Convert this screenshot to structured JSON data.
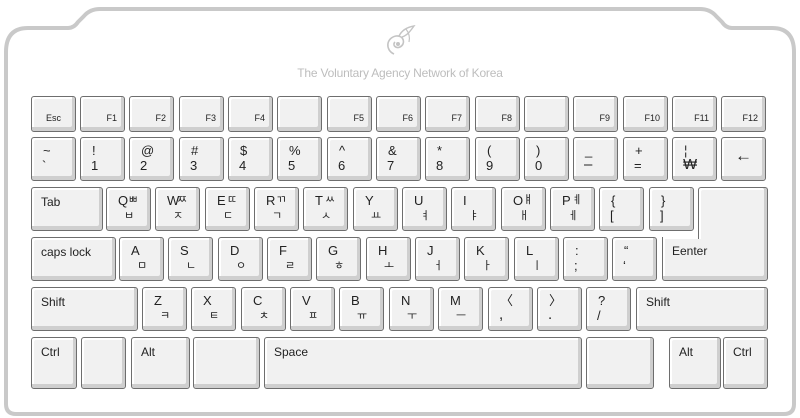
{
  "logo": {
    "text": "The Voluntary Agency Network of Korea",
    "icon": "leaf-swirl-icon"
  },
  "colors": {
    "frame": "#c9c9c9",
    "key_face": "#f1f1f1",
    "key_border": "#6e6e6e",
    "key_shade": "#cfcfcf",
    "logo": "#bdbdbd"
  },
  "rows": [
    {
      "keys": [
        {
          "id": "esc",
          "label": "Esc"
        },
        {
          "id": "f1",
          "label": "F1"
        },
        {
          "id": "f2",
          "label": "F2"
        },
        {
          "id": "f3",
          "label": "F3"
        },
        {
          "id": "f4",
          "label": "F4"
        },
        {
          "id": "blank-1",
          "label": ""
        },
        {
          "id": "f5",
          "label": "F5"
        },
        {
          "id": "f6",
          "label": "F6"
        },
        {
          "id": "f7",
          "label": "F7"
        },
        {
          "id": "f8",
          "label": "F8"
        },
        {
          "id": "blank-2",
          "label": ""
        },
        {
          "id": "f9",
          "label": "F9"
        },
        {
          "id": "f10",
          "label": "F10"
        },
        {
          "id": "f11",
          "label": "F11"
        },
        {
          "id": "f12",
          "label": "F12"
        }
      ]
    },
    {
      "keys": [
        {
          "id": "backtick",
          "top": "~",
          "bottom": "`"
        },
        {
          "id": "1",
          "top": "!",
          "bottom": "1"
        },
        {
          "id": "2",
          "top": "@",
          "bottom": "2"
        },
        {
          "id": "3",
          "top": "#",
          "bottom": "3"
        },
        {
          "id": "4",
          "top": "$",
          "bottom": "4"
        },
        {
          "id": "5",
          "top": "%",
          "bottom": "5"
        },
        {
          "id": "6",
          "top": "^",
          "bottom": "6"
        },
        {
          "id": "7",
          "top": "&",
          "bottom": "7"
        },
        {
          "id": "8",
          "top": "*",
          "bottom": "8"
        },
        {
          "id": "9",
          "top": "(",
          "bottom": "9"
        },
        {
          "id": "0",
          "top": ")",
          "bottom": "0"
        },
        {
          "id": "minus",
          "top": "_",
          "bottom": "–"
        },
        {
          "id": "equals",
          "top": "+",
          "bottom": "="
        },
        {
          "id": "won",
          "top": "¦",
          "bottom": "₩"
        },
        {
          "id": "backspace",
          "label": "←"
        }
      ]
    },
    {
      "keys": [
        {
          "id": "tab",
          "label": "Tab"
        },
        {
          "id": "q",
          "top": "Q",
          "han_top": "ㅃ",
          "han": "ㅂ"
        },
        {
          "id": "w",
          "top": "W",
          "han_top": "ㅉ",
          "han": "ㅈ"
        },
        {
          "id": "e",
          "top": "E",
          "han_top": "ㄸ",
          "han": "ㄷ"
        },
        {
          "id": "r",
          "top": "R",
          "han_top": "ㄲ",
          "han": "ㄱ"
        },
        {
          "id": "t",
          "top": "T",
          "han_top": "ㅆ",
          "han": "ㅅ"
        },
        {
          "id": "y",
          "top": "Y",
          "han": "ㅛ"
        },
        {
          "id": "u",
          "top": "U",
          "han": "ㅕ"
        },
        {
          "id": "i",
          "top": "I",
          "han": "ㅑ"
        },
        {
          "id": "o",
          "top": "O",
          "han_top": "ㅒ",
          "han": "ㅐ"
        },
        {
          "id": "p",
          "top": "P",
          "han_top": "ㅖ",
          "han": "ㅔ"
        },
        {
          "id": "lbracket",
          "top": "{",
          "bottom": "["
        },
        {
          "id": "rbracket",
          "top": "}",
          "bottom": "]"
        },
        {
          "id": "enter-top",
          "label": ""
        }
      ]
    },
    {
      "keys": [
        {
          "id": "caps",
          "label": "caps lock"
        },
        {
          "id": "a",
          "top": "A",
          "han": "ㅁ"
        },
        {
          "id": "s",
          "top": "S",
          "han": "ㄴ"
        },
        {
          "id": "d",
          "top": "D",
          "han": "ㅇ"
        },
        {
          "id": "f",
          "top": "F",
          "han": "ㄹ"
        },
        {
          "id": "g",
          "top": "G",
          "han": "ㅎ"
        },
        {
          "id": "h",
          "top": "H",
          "han": "ㅗ"
        },
        {
          "id": "j",
          "top": "J",
          "han": "ㅓ"
        },
        {
          "id": "k",
          "top": "K",
          "han": "ㅏ"
        },
        {
          "id": "l",
          "top": "L",
          "han": "ㅣ"
        },
        {
          "id": "semicolon",
          "top": ":",
          "bottom": ";"
        },
        {
          "id": "quote",
          "top": "“",
          "bottom": "‘"
        },
        {
          "id": "enter",
          "label": "Eenter"
        }
      ]
    },
    {
      "keys": [
        {
          "id": "lshift",
          "label": "Shift"
        },
        {
          "id": "z",
          "top": "Z",
          "han": "ㅋ"
        },
        {
          "id": "x",
          "top": "X",
          "han": "ㅌ"
        },
        {
          "id": "c",
          "top": "C",
          "han": "ㅊ"
        },
        {
          "id": "v",
          "top": "V",
          "han": "ㅍ"
        },
        {
          "id": "b",
          "top": "B",
          "han": "ㅠ"
        },
        {
          "id": "n",
          "top": "N",
          "han": "ㅜ"
        },
        {
          "id": "m",
          "top": "M",
          "han": "ㅡ"
        },
        {
          "id": "comma",
          "top": "〈",
          "bottom": ","
        },
        {
          "id": "period",
          "top": "〉",
          "bottom": "."
        },
        {
          "id": "slash",
          "top": "?",
          "bottom": "/"
        },
        {
          "id": "rshift",
          "label": "Shift"
        }
      ]
    },
    {
      "keys": [
        {
          "id": "lctrl",
          "label": "Ctrl"
        },
        {
          "id": "lwin",
          "label": ""
        },
        {
          "id": "lalt",
          "label": "Alt"
        },
        {
          "id": "hanja",
          "label": ""
        },
        {
          "id": "space",
          "label": "Space"
        },
        {
          "id": "hangul",
          "label": ""
        },
        {
          "id": "ralt",
          "label": "Alt"
        },
        {
          "id": "rctrl",
          "label": "Ctrl"
        }
      ]
    }
  ]
}
